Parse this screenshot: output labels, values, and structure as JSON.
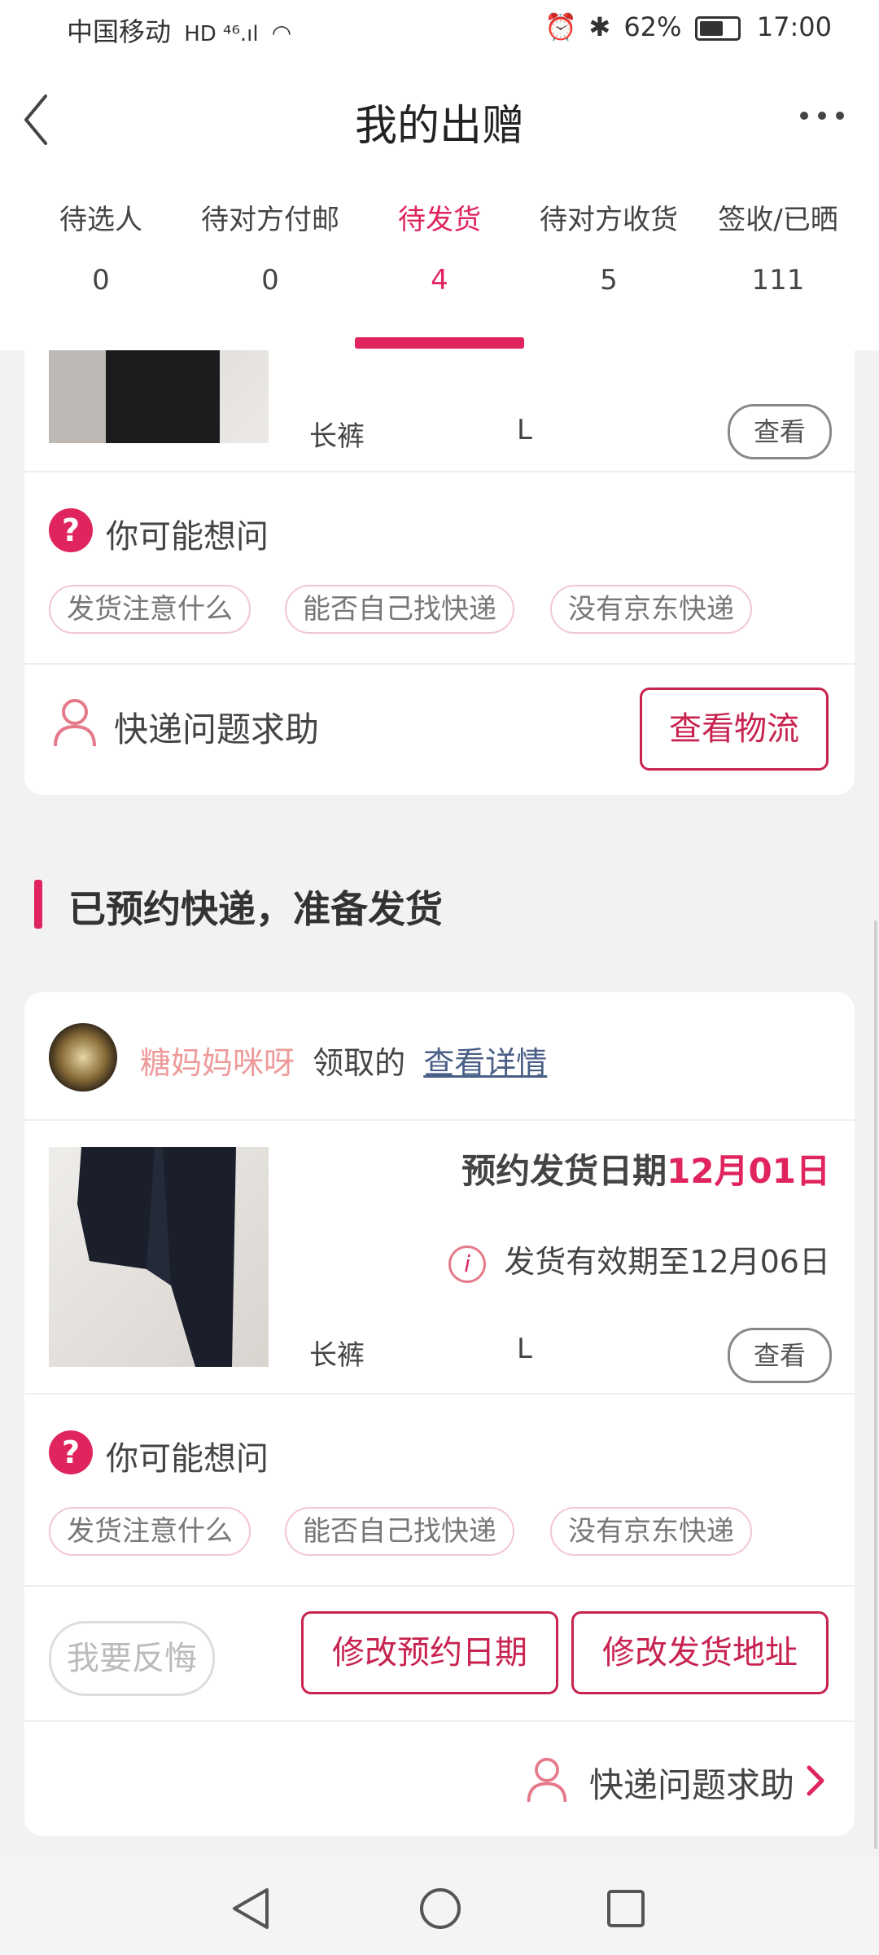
{
  "status_bar": {
    "carrier": "中国移动",
    "network": "HD ⁴⁶.ıl",
    "battery": "62%",
    "time": "17:00"
  },
  "header": {
    "title": "我的出赠",
    "back_icon": "chevron-left-icon",
    "more_icon": "more-horizontal-icon"
  },
  "tabs": [
    {
      "label": "待选人",
      "count": "0"
    },
    {
      "label": "待对方付邮",
      "count": "0"
    },
    {
      "label": "待发货",
      "count": "4",
      "active": true
    },
    {
      "label": "待对方收货",
      "count": "5"
    },
    {
      "label": "签收/已晒",
      "count": "111"
    }
  ],
  "colors": {
    "accent": "#e0245e",
    "button_border": "#c8234f",
    "nickname": "#ee9a9a",
    "link": "#4a5f86"
  },
  "card1": {
    "item_name": "长裤",
    "item_size": "L",
    "view_label": "查看",
    "question_title": "你可能想问",
    "chips": [
      "发货注意什么",
      "能否自己找快递",
      "没有京东快递"
    ],
    "help_label": "快递问题求助",
    "logistics_label": "查看物流"
  },
  "section": {
    "title": "已预约快递，准备发货"
  },
  "card2": {
    "nickname": "糖妈妈咪呀",
    "claimed_text": "领取的",
    "details_link": "查看详情",
    "ship_date_label": "预约发货日期",
    "ship_date_value": "12月01日",
    "validity_text": "发货有效期至12月06日",
    "item_name": "长裤",
    "item_size": "L",
    "view_label": "查看",
    "question_title": "你可能想问",
    "chips": [
      "发货注意什么",
      "能否自己找快递",
      "没有京东快递"
    ],
    "regret_label": "我要反悔",
    "modify_date_label": "修改预约日期",
    "modify_address_label": "修改发货地址",
    "help_label": "快递问题求助"
  },
  "nav_bar": {
    "back_icon": "triangle-back-icon",
    "home_icon": "circle-home-icon",
    "recents_icon": "square-recents-icon"
  }
}
